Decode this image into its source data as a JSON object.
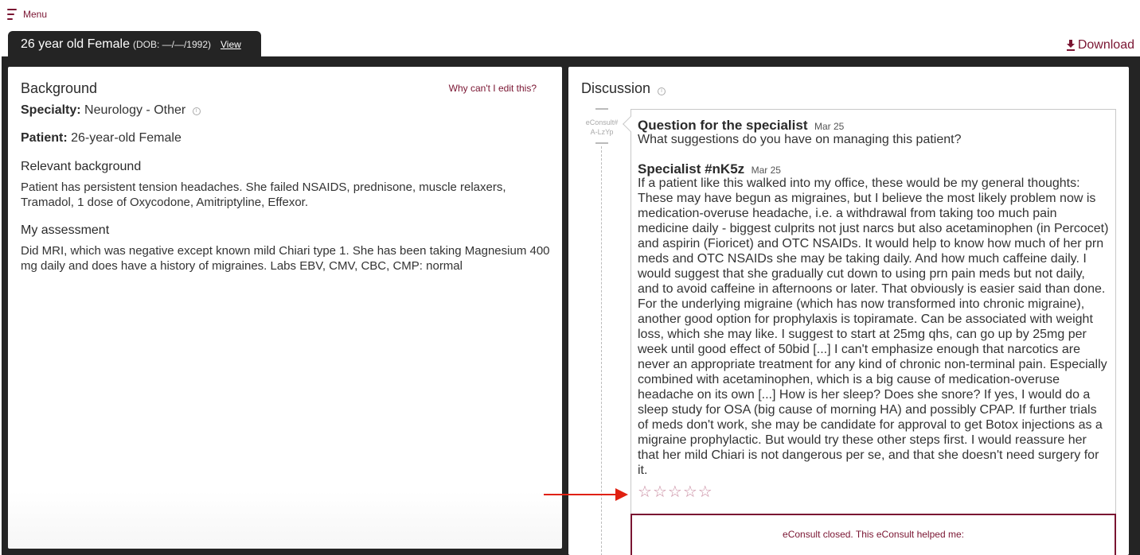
{
  "menu": {
    "label": "Menu",
    "icon": "hamburger-menu-icon"
  },
  "patient_tab": {
    "name": "26 year old Female",
    "dob": "(DOB: —/—/1992)",
    "view_link": "View"
  },
  "download": {
    "label": "Download",
    "icon": "download-icon"
  },
  "background": {
    "title": "Background",
    "why_edit_link": "Why can't I edit this?",
    "specialty_label": "Specialty:",
    "specialty_value": "Neurology - Other",
    "patient_label": "Patient:",
    "patient_value": "26-year-old Female",
    "relevant_heading": "Relevant background",
    "relevant_text": "Patient has persistent tension headaches. She failed NSAIDS, prednisone, muscle relaxers, Tramadol, 1 dose of Oxycodone, Amitriptyline, Effexor.",
    "assessment_heading": "My assessment",
    "assessment_text": "Did MRI, which was negative except known mild Chiari type 1. She has been taking Magnesium 400 mg daily and does have a history of migraines. Labs EBV, CMV, CBC, CMP: normal"
  },
  "discussion": {
    "title": "Discussion",
    "econsult_label": "eConsult#",
    "econsult_id": "A-LzYp",
    "question": {
      "heading": "Question for the specialist",
      "date": "Mar 25",
      "text": "What suggestions do you have on managing this patient?"
    },
    "specialist": {
      "heading": "Specialist #nK5z",
      "date": "Mar 25",
      "text": "If a patient like this walked into my office, these would be my general thoughts: These may have begun as migraines, but I believe the most likely problem now is medication-overuse headache, i.e. a withdrawal from taking too much pain medicine daily - biggest culprits not just narcs but also acetaminophen (in Percocet) and aspirin (Fioricet) and OTC NSAIDs. It would help to know how much of her prn meds and OTC NSAIDs she may be taking daily. And how much caffeine daily. I would suggest that she gradually cut down to using prn pain meds but not daily, and to avoid caffeine in afternoons or later. That obviously is easier said than done. For the underlying migraine (which has now transformed into chronic migraine), another good option for prophylaxis is topiramate. Can be associated with weight loss, which she may like. I suggest to start at 25mg qhs, can go up by 25mg per week until good effect of 50bid [...] I can't emphasize enough that narcotics are never an appropriate treatment for any kind of chronic non-terminal pain. Especially combined with acetaminophen, which is a big cause of medication-overuse headache on its own [...] How is her sleep? Does she snore? If yes, I would do a sleep study for OSA (big cause of morning HA) and possibly CPAP. If further trials of meds don't work, she may be candidate for approval to get Botox injections as a migraine prophylactic. But would try these other steps first. I would reassure her that her mild Chiari is not dangerous per se, and that she doesn't need surgery for it."
    },
    "rating": {
      "max": 5,
      "value": 0,
      "glyph": "☆"
    },
    "closed_text": "eConsult closed. This eConsult helped me:"
  },
  "colors": {
    "brand": "#7a1532",
    "frame": "#242424",
    "star": "#c98ba0",
    "annotation_arrow": "#e02010"
  }
}
